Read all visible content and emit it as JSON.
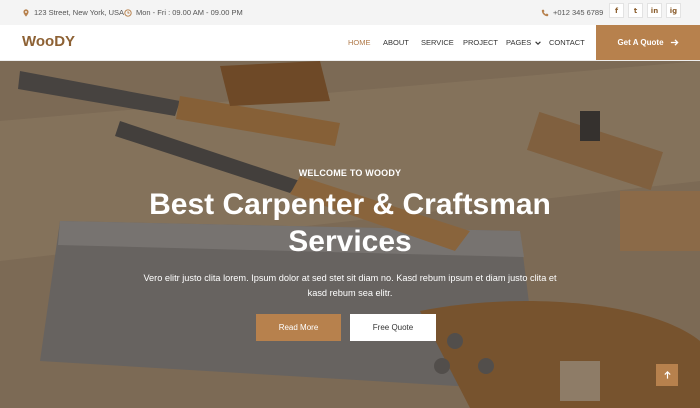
{
  "topbar": {
    "address": "123 Street, New York, USA",
    "hours": "Mon - Fri : 09.00 AM - 09.00 PM",
    "phone": "+012 345 6789",
    "socials": [
      "f",
      "t",
      "in",
      "ig"
    ]
  },
  "navbar": {
    "logo": "WooDY",
    "items": [
      {
        "label": "HOME",
        "active": true
      },
      {
        "label": "ABOUT"
      },
      {
        "label": "SERVICE"
      },
      {
        "label": "PROJECT"
      },
      {
        "label": "PAGES"
      },
      {
        "label": "CONTACT"
      }
    ],
    "cta": "Get A Quote"
  },
  "hero": {
    "welcome": "WELCOME TO WOODY",
    "headline": "Best Carpenter & Craftsman Services",
    "subtext": "Vero elitr justo clita lorem. Ipsum dolor at sed stet sit diam no. Kasd rebum ipsum et diam justo clita et kasd rebum sea elitr.",
    "read_more": "Read More",
    "free_quote": "Free Quote"
  },
  "colors": {
    "accent": "#b7814d",
    "logo": "#8d6134"
  }
}
